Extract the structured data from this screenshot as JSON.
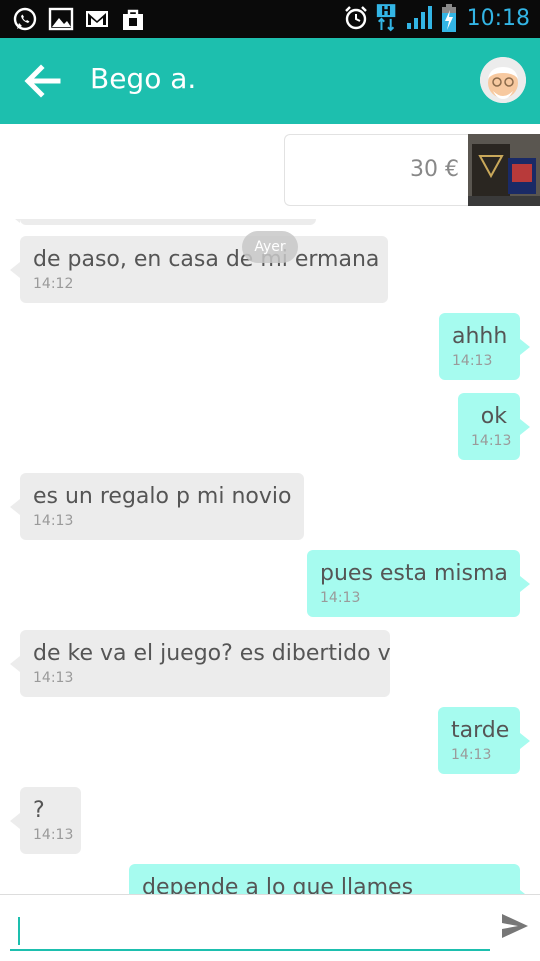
{
  "status_bar": {
    "time": "10:18",
    "network_label": "H",
    "notification_icons": [
      "whatsapp-icon",
      "gallery-icon",
      "gmail-icon",
      "shopping-bag-icon"
    ],
    "right_icons": [
      "alarm-icon",
      "network-h-icon",
      "signal-icon",
      "battery-charging-icon"
    ]
  },
  "header": {
    "contact_name": "Bego a.",
    "back_icon": "arrow-back-icon",
    "avatar_icon": "avatar-icon",
    "accent_color": "#1dbfae"
  },
  "product": {
    "price": "30 €"
  },
  "date_divider": "Ayer",
  "messages": [
    {
      "dir": "in",
      "text": "de paso, en casa de mi ermana",
      "time": "14:12"
    },
    {
      "dir": "out",
      "text": "ahhh",
      "time": "14:13"
    },
    {
      "dir": "out",
      "text": "ok",
      "time": "14:13"
    },
    {
      "dir": "in",
      "text": "es un regalo p mi novio",
      "time": "14:13"
    },
    {
      "dir": "out",
      "text": "pues esta misma",
      "time": "14:13"
    },
    {
      "dir": "in",
      "text": "de ke va el juego? es dibertido v",
      "time": "14:13"
    },
    {
      "dir": "out",
      "text": "tarde",
      "time": "14:13"
    },
    {
      "dir": "in",
      "text": "?",
      "time": "14:13"
    },
    {
      "dir": "out",
      "text": "depende a lo que llames",
      "time": ""
    }
  ],
  "composer": {
    "value": "",
    "send_icon": "send-icon"
  },
  "colors": {
    "incoming_bubble": "#ececec",
    "outgoing_bubble": "#a6fbef",
    "status_time": "#33b5e5"
  }
}
